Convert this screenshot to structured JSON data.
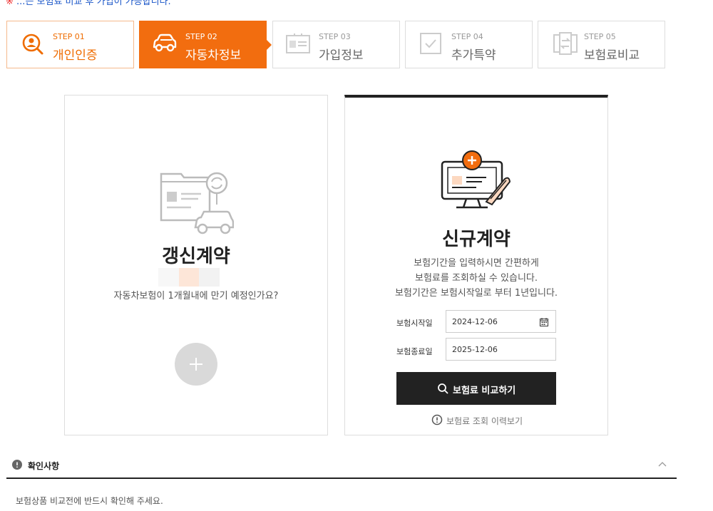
{
  "top_notice": {
    "marker": "※",
    "text": "...는 보험료 비교 후 가입이 가능합니다."
  },
  "steps": [
    {
      "num": "STEP 01",
      "title": "개인인증",
      "icon": "user-search-icon",
      "state": "done"
    },
    {
      "num": "STEP 02",
      "title": "자동차정보",
      "icon": "car-icon",
      "state": "active"
    },
    {
      "num": "STEP 03",
      "title": "가입정보",
      "icon": "id-card-icon",
      "state": "todo"
    },
    {
      "num": "STEP 04",
      "title": "추가특약",
      "icon": "checkbox-icon",
      "state": "todo"
    },
    {
      "num": "STEP 05",
      "title": "보험료비교",
      "icon": "compare-icon",
      "state": "todo"
    }
  ],
  "renew_card": {
    "title": "갱신계약",
    "desc": "자동차보험이 1개월내에 만기 예정인가요?",
    "icon": "renewal-car-document-icon",
    "add_icon": "plus-icon"
  },
  "new_card": {
    "title": "신규계약",
    "desc_lines": [
      "보험기간을 입력하시면 간편하게",
      "보험료를 조회하실 수 있습니다.",
      "보험기간은 보험시작일로 부터 1년입니다."
    ],
    "icon": "monitor-plus-icon",
    "start_label": "보험시작일",
    "start_value": "2024-12-06",
    "end_label": "보험종료일",
    "end_value": "2025-12-06",
    "calendar_icon": "calendar-icon",
    "compare_button": "보험료 비교하기",
    "history_link": "보험료 조회 이력보기"
  },
  "notice": {
    "title": "확인사항",
    "body": "보험상품 비교전에 반드시 확인해 주세요."
  },
  "colors": {
    "accent": "#f26d0f",
    "dark": "#222222",
    "muted": "#d9d9d9"
  }
}
